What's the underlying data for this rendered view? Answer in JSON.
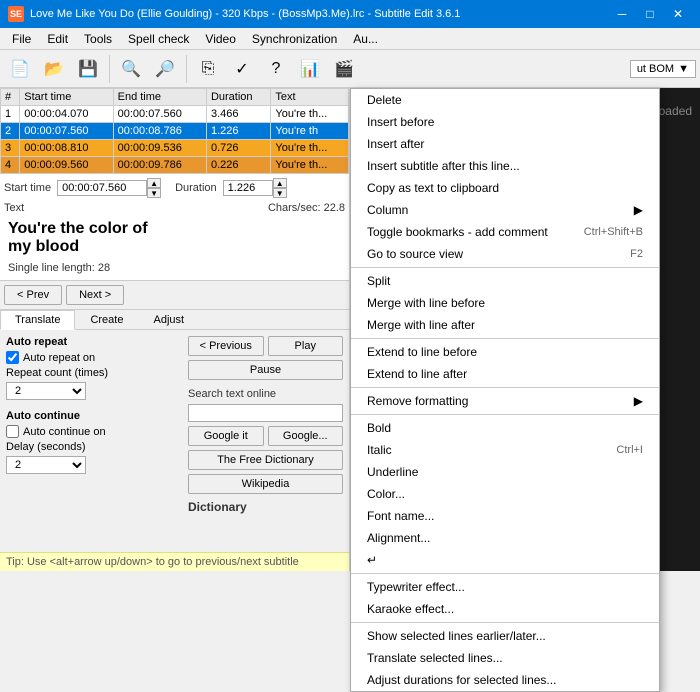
{
  "titlebar": {
    "title": "Love Me Like You Do (Ellie Goulding) - 320 Kbps - (BossMp3.Me).lrc - Subtitle Edit 3.6.1",
    "icon": "SE",
    "minimize": "─",
    "maximize": "□",
    "close": "✕"
  },
  "menubar": {
    "items": [
      "File",
      "Edit",
      "Tools",
      "Spell check",
      "Video",
      "Synchronization",
      "Au..."
    ]
  },
  "toolbar": {
    "bom_label": "ut BOM"
  },
  "table": {
    "headers": [
      "#",
      "Start time",
      "End time",
      "Duration",
      "Text"
    ],
    "rows": [
      {
        "num": "1",
        "start": "00:00:04.070",
        "end": "00:00:07.560",
        "duration": "3.466",
        "text": "You're th...",
        "style": "normal"
      },
      {
        "num": "2",
        "start": "00:00:07.560",
        "end": "00:00:08.786",
        "duration": "1.226",
        "text": "You're th",
        "style": "selected"
      },
      {
        "num": "3",
        "start": "00:00:08.810",
        "end": "00:00:09.536",
        "duration": "0.726",
        "text": "You're th...",
        "style": "orange"
      },
      {
        "num": "4",
        "start": "00:00:09.560",
        "end": "00:00:09.786",
        "duration": "0.226",
        "text": "You're th...",
        "style": "orange2"
      }
    ]
  },
  "edit": {
    "start_time_label": "Start time",
    "duration_label": "Duration",
    "start_time_value": "00:00:07.560",
    "duration_value": "1.226",
    "text_label": "Text",
    "chars_label": "Chars/sec: 22.8",
    "subtitle_text": "You're the color of\nmy blood",
    "single_line_label": "Single line length: 28"
  },
  "nav": {
    "prev_label": "< Prev",
    "next_label": "Next >"
  },
  "tabs": {
    "items": [
      "Translate",
      "Create",
      "Adjust"
    ],
    "active": 0
  },
  "translate": {
    "auto_repeat_label": "Auto repeat",
    "auto_repeat_on_label": "Auto repeat on",
    "repeat_count_label": "Repeat count (times)",
    "repeat_count_value": "2",
    "auto_continue_label": "Auto continue",
    "auto_continue_on_label": "Auto continue on",
    "delay_label": "Delay (seconds)",
    "delay_value": "2"
  },
  "right_panel": {
    "previous_label": "< Previous",
    "play_label": "Play",
    "pause_label": "Pause",
    "search_label": "Search text online",
    "search_placeholder": "",
    "google_label": "Google it",
    "google2_label": "Google...",
    "free_dict_label": "The Free Dictionary",
    "wikipedia_label": "Wikipedia",
    "dictionary_label": "Dictionary"
  },
  "video": {
    "loaded_text": "Video loaded"
  },
  "statusbar": {
    "tip": "Tip: Use <alt+arrow up/down> to go to previous/next subtitle"
  },
  "context_menu": {
    "items": [
      {
        "label": "Delete",
        "shortcut": "",
        "has_submenu": false,
        "separator_after": false
      },
      {
        "label": "Insert before",
        "shortcut": "",
        "has_submenu": false,
        "separator_after": false
      },
      {
        "label": "Insert after",
        "shortcut": "",
        "has_submenu": false,
        "separator_after": false
      },
      {
        "label": "Insert subtitle after this line...",
        "shortcut": "",
        "has_submenu": false,
        "separator_after": false
      },
      {
        "label": "Copy as text to clipboard",
        "shortcut": "",
        "has_submenu": false,
        "separator_after": false
      },
      {
        "label": "Column",
        "shortcut": "",
        "has_submenu": true,
        "separator_after": false
      },
      {
        "label": "Toggle bookmarks - add comment",
        "shortcut": "Ctrl+Shift+B",
        "has_submenu": false,
        "separator_after": false
      },
      {
        "label": "Go to source view",
        "shortcut": "F2",
        "has_submenu": false,
        "separator_after": true
      },
      {
        "label": "Split",
        "shortcut": "",
        "has_submenu": false,
        "separator_after": false
      },
      {
        "label": "Merge with line before",
        "shortcut": "",
        "has_submenu": false,
        "separator_after": false
      },
      {
        "label": "Merge with line after",
        "shortcut": "",
        "has_submenu": false,
        "separator_after": true
      },
      {
        "label": "Extend to line before",
        "shortcut": "",
        "has_submenu": false,
        "separator_after": false
      },
      {
        "label": "Extend to line after",
        "shortcut": "",
        "has_submenu": false,
        "separator_after": true
      },
      {
        "label": "Remove formatting",
        "shortcut": "",
        "has_submenu": true,
        "separator_after": true
      },
      {
        "label": "Bold",
        "shortcut": "",
        "has_submenu": false,
        "separator_after": false
      },
      {
        "label": "Italic",
        "shortcut": "Ctrl+I",
        "has_submenu": false,
        "separator_after": false
      },
      {
        "label": "Underline",
        "shortcut": "",
        "has_submenu": false,
        "separator_after": false
      },
      {
        "label": "Color...",
        "shortcut": "",
        "has_submenu": false,
        "separator_after": false
      },
      {
        "label": "Font name...",
        "shortcut": "",
        "has_submenu": false,
        "separator_after": false
      },
      {
        "label": "Alignment...",
        "shortcut": "",
        "has_submenu": false,
        "separator_after": false
      },
      {
        "label": "↵",
        "shortcut": "",
        "has_submenu": false,
        "separator_after": true
      },
      {
        "label": "Typewriter effect...",
        "shortcut": "",
        "has_submenu": false,
        "separator_after": false
      },
      {
        "label": "Karaoke effect...",
        "shortcut": "",
        "has_submenu": false,
        "separator_after": true
      },
      {
        "label": "Show selected lines earlier/later...",
        "shortcut": "",
        "has_submenu": false,
        "separator_after": false
      },
      {
        "label": "Translate selected lines...",
        "shortcut": "",
        "has_submenu": false,
        "separator_after": false
      },
      {
        "label": "Adjust durations for selected lines...",
        "shortcut": "",
        "has_submenu": false,
        "separator_after": false
      }
    ]
  }
}
